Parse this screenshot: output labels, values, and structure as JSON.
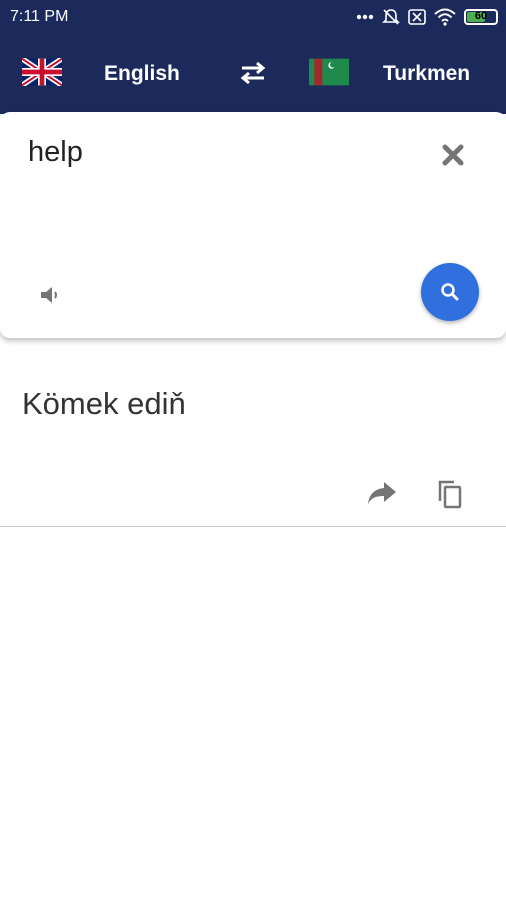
{
  "status_bar": {
    "time": "7:11 PM",
    "battery": "60",
    "icons": [
      "more-dots-icon",
      "mute-icon",
      "sim-icon",
      "wifi-icon",
      "battery-icon"
    ]
  },
  "app_bar": {
    "source_language": "English",
    "target_language": "Turkmen",
    "source_flag": "uk-flag-icon",
    "target_flag": "turkmenistan-flag-icon",
    "swap_icon": "swap-arrows-icon"
  },
  "input_card": {
    "input_text": "help",
    "clear_icon": "close-icon",
    "speak_icon": "speaker-icon",
    "search_icon": "search-icon"
  },
  "output": {
    "translated_text": "Kömek ediň",
    "share_icon": "share-icon",
    "copy_icon": "copy-icon"
  },
  "colors": {
    "header": "#1b2a5b",
    "accent": "#2f6fde",
    "icon_gray": "#757575"
  }
}
